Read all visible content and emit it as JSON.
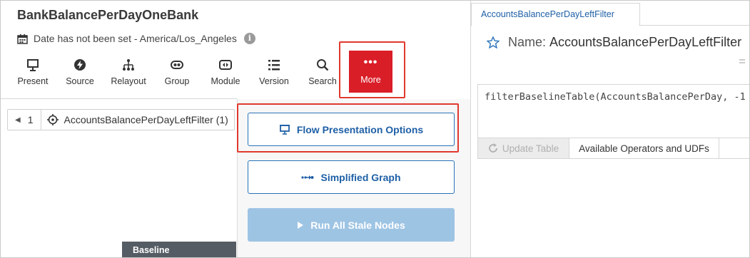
{
  "flow": {
    "title": "BankBalancePerDayOneBank",
    "date_text": "Date has not been set - America/Los_Angeles"
  },
  "toolbar": {
    "items": [
      {
        "label": "Present",
        "icon": "presentation-icon"
      },
      {
        "label": "Source",
        "icon": "lightning-icon"
      },
      {
        "label": "Relayout",
        "icon": "graph-nodes-icon"
      },
      {
        "label": "Group",
        "icon": "group-icon"
      },
      {
        "label": "Module",
        "icon": "module-icon"
      },
      {
        "label": "Version",
        "icon": "list-icon"
      },
      {
        "label": "Search",
        "icon": "search-icon"
      }
    ],
    "more_label": "More",
    "more_dots": "•••"
  },
  "breadcrumb": {
    "page": "1",
    "node_label": "AccountsBalancePerDayLeftFilter (1)"
  },
  "menu": {
    "flow_presentation": "Flow Presentation Options",
    "simplified_graph": "Simplified Graph",
    "run_stale": "Run All Stale Nodes"
  },
  "status": {
    "baseline": "Baseline"
  },
  "right": {
    "tab_label": "AccountsBalancePerDayLeftFilter",
    "name_label": "Name:",
    "name_value": "AccountsBalancePerDayLeftFilter",
    "code": "filterBaselineTable(AccountsBalancePerDay, -1",
    "update_table": "Update Table",
    "available_ops": "Available Operators and UDFs"
  },
  "colors": {
    "accent_red": "#da1e28",
    "link_blue": "#1e5fa6",
    "highlight_outline": "#e0392f"
  }
}
